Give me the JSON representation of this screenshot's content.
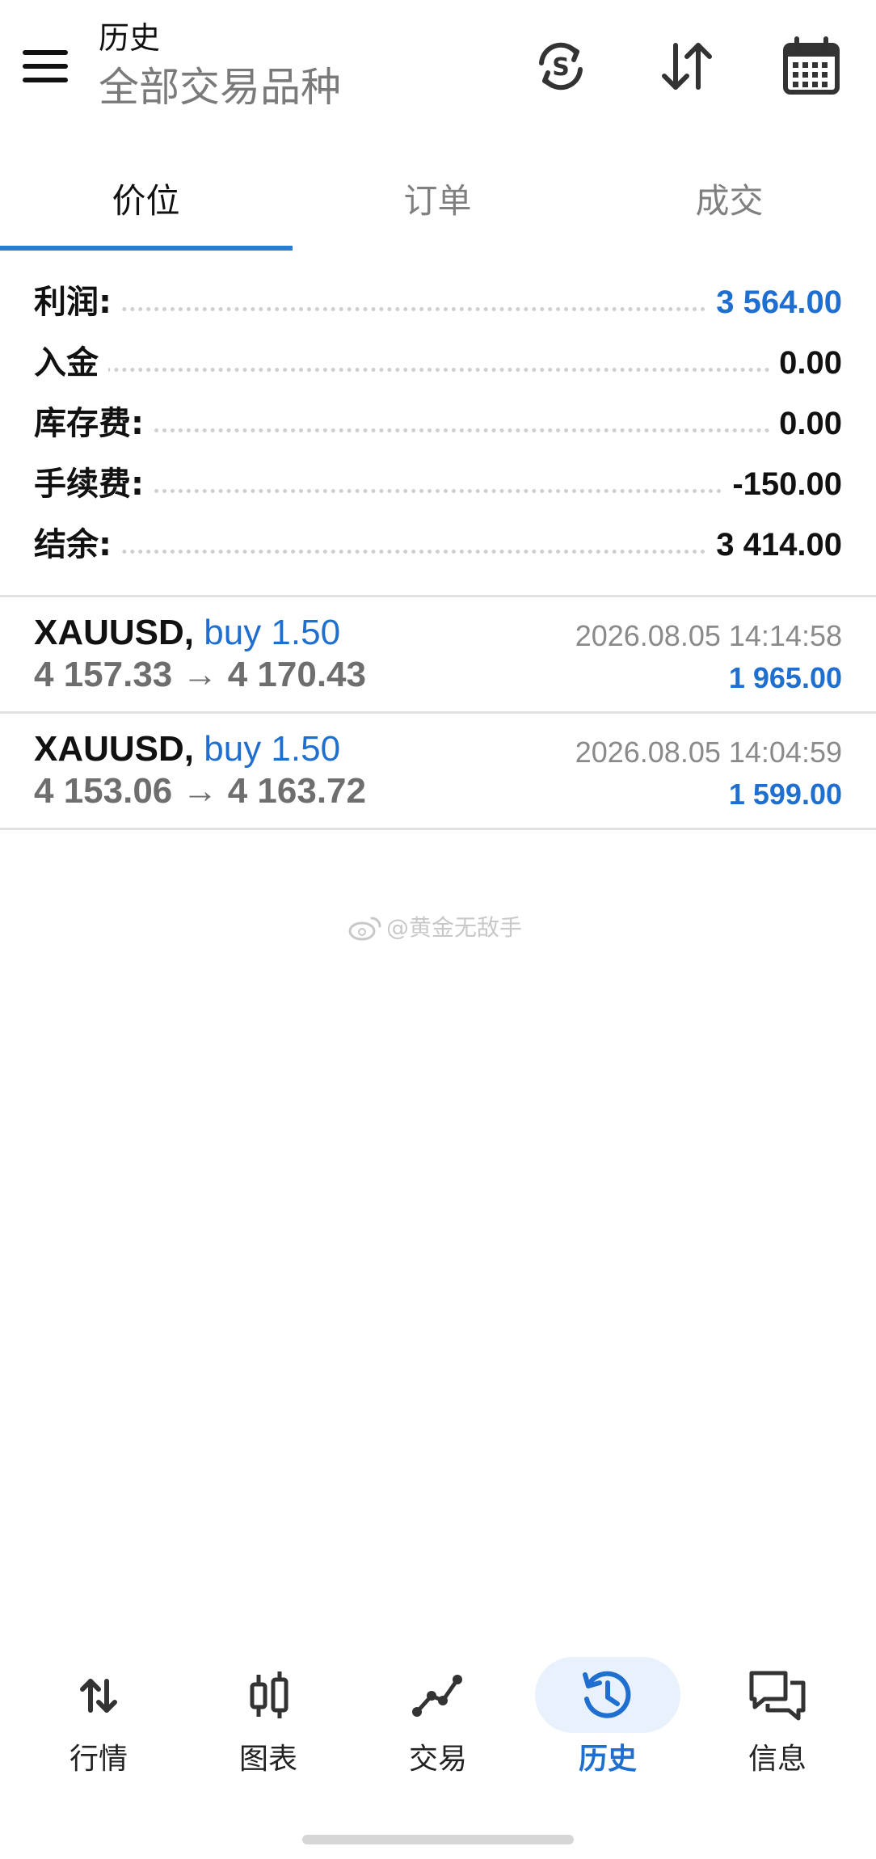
{
  "header": {
    "title_small": "历史",
    "title_large": "全部交易品种"
  },
  "tabs": [
    {
      "label": "价位",
      "active": true
    },
    {
      "label": "订单",
      "active": false
    },
    {
      "label": "成交",
      "active": false
    }
  ],
  "summary": [
    {
      "label": "利润:",
      "value": "3 564.00",
      "highlight": true
    },
    {
      "label": "入金",
      "value": "0.00",
      "highlight": false
    },
    {
      "label": "库存费:",
      "value": "0.00",
      "highlight": false
    },
    {
      "label": "手续费:",
      "value": "-150.00",
      "highlight": false
    },
    {
      "label": "结余:",
      "value": "3 414.00",
      "highlight": false
    }
  ],
  "deals": [
    {
      "symbol": "XAUUSD,",
      "side": "buy 1.50",
      "prices": "4 157.33 → 4 170.43",
      "time": "2026.08.05 14:14:58",
      "profit": "1 965.00"
    },
    {
      "symbol": "XAUUSD,",
      "side": "buy 1.50",
      "prices": "4 153.06 → 4 163.72",
      "time": "2026.08.05 14:04:59",
      "profit": "1 599.00"
    }
  ],
  "watermark": "@黄金无敌手",
  "bottom_nav": [
    {
      "label": "行情",
      "icon": "quotes-arrows-icon",
      "active": false
    },
    {
      "label": "图表",
      "icon": "candlestick-chart-icon",
      "active": false
    },
    {
      "label": "交易",
      "icon": "trade-line-icon",
      "active": false
    },
    {
      "label": "历史",
      "icon": "history-clock-icon",
      "active": true
    },
    {
      "label": "信息",
      "icon": "messages-icon",
      "active": false
    }
  ],
  "colors": {
    "accent": "#1f6fd1",
    "tab_indicator": "#2f7ad6",
    "active_nav_bg": "#e8f1fc"
  }
}
